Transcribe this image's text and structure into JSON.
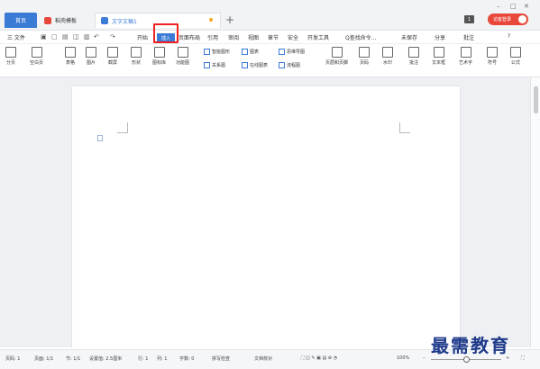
{
  "titlebar": {
    "tabs": [
      {
        "label": "首页"
      },
      {
        "label": "稻壳模板"
      },
      {
        "label": "文字文稿1"
      }
    ],
    "badge": "1",
    "login": "访客登录"
  },
  "menubar": {
    "file": "三 文件",
    "items": [
      "开始",
      "插入",
      "页面布局",
      "引用",
      "审阅",
      "视图",
      "章节",
      "安全",
      "开发工具"
    ],
    "search": "Q查找命令...",
    "right": [
      "未保存",
      "分享",
      "批注"
    ],
    "help": "?"
  },
  "ribbon": {
    "large": [
      "分页",
      "空白页",
      "表格",
      "图片",
      "截屏",
      "形状",
      "图标库",
      "功能图",
      "页眉和页脚",
      "页码",
      "水印",
      "批注",
      "文本框",
      "艺术字",
      "符号",
      "公式"
    ],
    "small_col1": [
      "智能图形",
      "关系图"
    ],
    "small_col2": [
      "图表",
      "在线图表"
    ],
    "small_col3": [
      "思维导图",
      "流程图"
    ]
  },
  "status": {
    "page_num": "页码: 1",
    "pages": "页面: 1/1",
    "section": "节: 1/1",
    "setting": "设置值: 2.5厘米",
    "row": "行: 1",
    "col": "列: 1",
    "words": "字数: 0",
    "spell": "拼写检查",
    "proof": "文档校对",
    "zoom": "100%"
  },
  "watermark": "最需教育"
}
